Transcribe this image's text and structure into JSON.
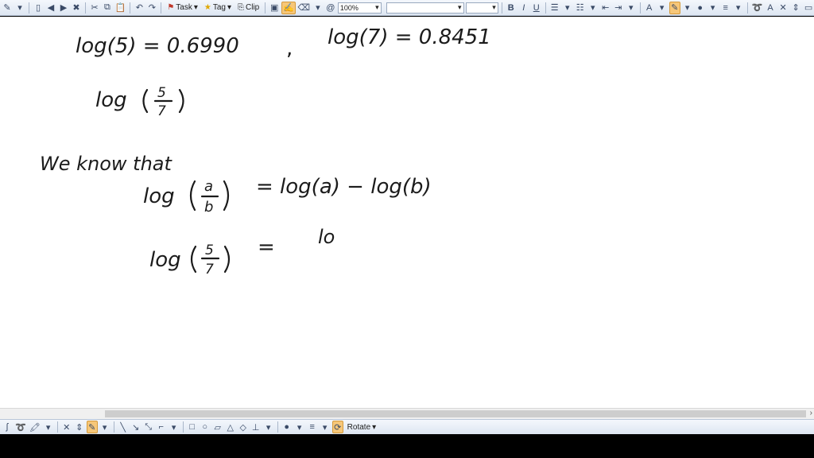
{
  "toolbar": {
    "task_label": "Task",
    "tag_label": "Tag",
    "clip_label": "Clip",
    "zoom_value": "100%",
    "font_value": "",
    "size_value": "",
    "bold_label": "B",
    "italic_label": "I",
    "underline_label": "U",
    "font_color_label": "A",
    "grow_label": "A"
  },
  "bottombar": {
    "rotate_label": "Rotate"
  },
  "note": {
    "line1_left": "log(5) = 0.6990",
    "comma": ",",
    "line1_right": "log(7) = 0.8451",
    "line2_log": "log",
    "frac1_num": "5",
    "frac1_den": "7",
    "we_know": "We know that",
    "rule_log": "log",
    "rule_num": "a",
    "rule_den": "b",
    "rule_rhs": "= log(a) − log(b)",
    "line5_log": "log",
    "frac3_num": "5",
    "frac3_den": "7",
    "line5_eq": "=",
    "line5_partial": "lo"
  },
  "colors": {
    "accent": "#f6c779",
    "ink": "#1b1b1b",
    "toolbar_bg": "#dde6f2"
  }
}
